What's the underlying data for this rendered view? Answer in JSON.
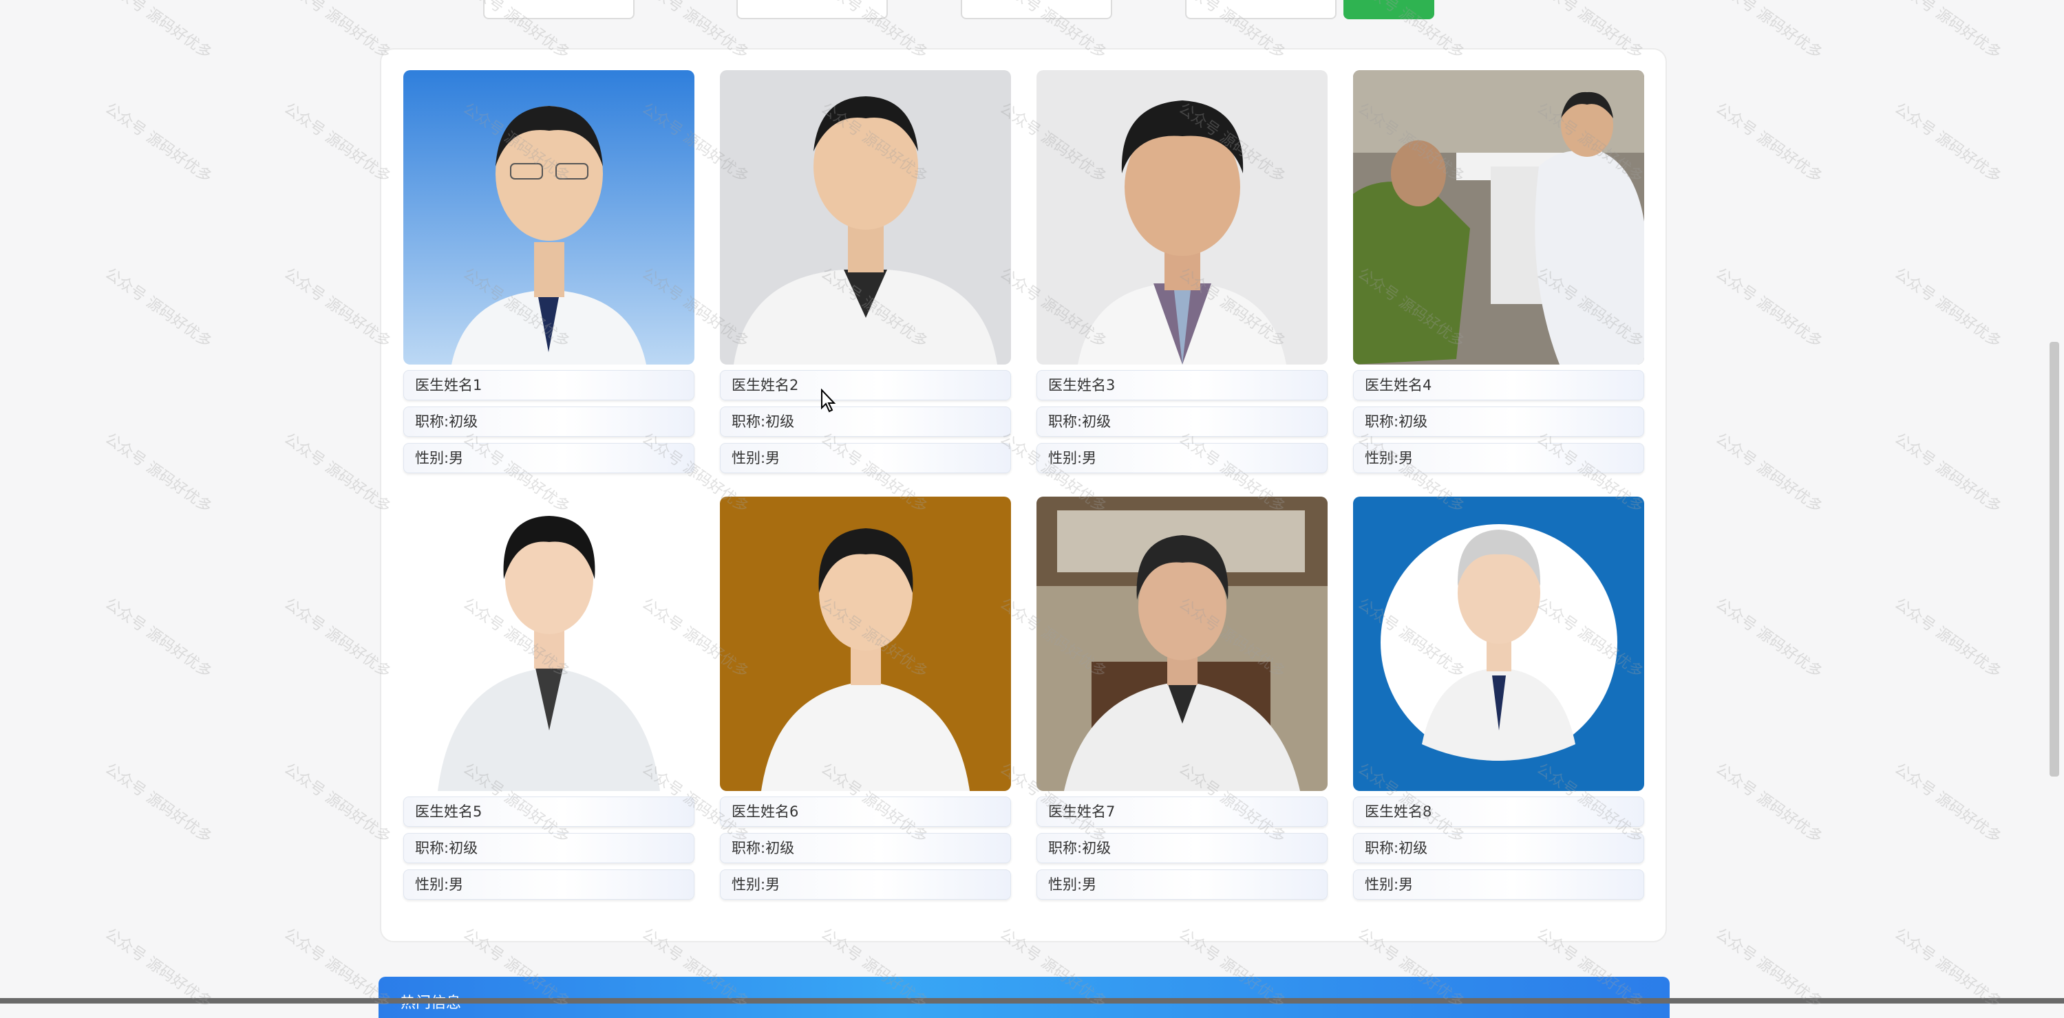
{
  "doctors": [
    {
      "name": "医生姓名1",
      "title": "职称:初级",
      "gender": "性别:男"
    },
    {
      "name": "医生姓名2",
      "title": "职称:初级",
      "gender": "性别:男"
    },
    {
      "name": "医生姓名3",
      "title": "职称:初级",
      "gender": "性别:男"
    },
    {
      "name": "医生姓名4",
      "title": "职称:初级",
      "gender": "性别:男"
    },
    {
      "name": "医生姓名5",
      "title": "职称:初级",
      "gender": "性别:男"
    },
    {
      "name": "医生姓名6",
      "title": "职称:初级",
      "gender": "性别:男"
    },
    {
      "name": "医生姓名7",
      "title": "职称:初级",
      "gender": "性别:男"
    },
    {
      "name": "医生姓名8",
      "title": "职称:初级",
      "gender": "性别:男"
    }
  ],
  "hot_section": {
    "title": "热门信息"
  },
  "watermark": "公众号 源码好优多",
  "colors": {
    "search_button": "#2fb351",
    "section_bar": "#2b7de9"
  },
  "icons": {
    "cursor": "mouse-pointer-icon"
  }
}
